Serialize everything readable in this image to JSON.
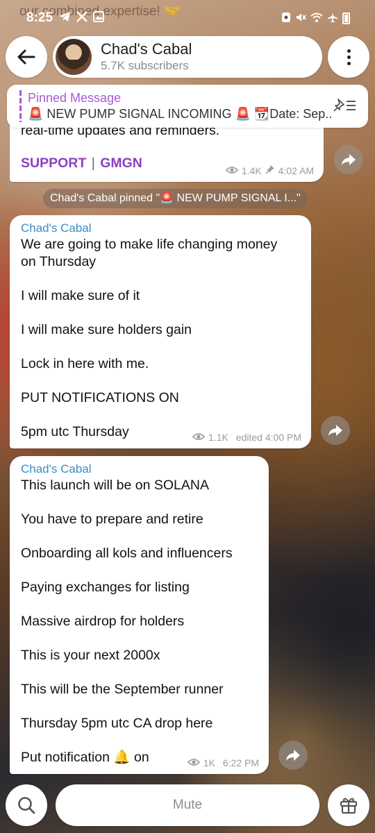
{
  "status_bar": {
    "time": "8:25",
    "left_icons": [
      "telegram-icon",
      "x-icon",
      "gallery-icon"
    ],
    "right_icons": [
      "nfc-icon",
      "mute-icon",
      "wifi-icon",
      "airplane-icon",
      "battery-icon"
    ]
  },
  "background_text": "our combined expertise! 🤝",
  "header": {
    "channel_name": "Chad's Cabal",
    "subscribers": "5.7K subscribers"
  },
  "pinned": {
    "title": "Pinned Message",
    "preview": "🚨 NEW PUMP SIGNAL INCOMING 🚨 📆Date: Sep..."
  },
  "messages": [
    {
      "partial_text": "real-time updates and reminders.",
      "links": [
        "SUPPORT",
        "GMGN"
      ],
      "link_separator": "|",
      "views": "1.4K",
      "time": "4:02 AM"
    },
    {
      "sender": "Chad's Cabal",
      "lines": [
        "We are going to make life changing money",
        "on Thursday",
        "",
        "I will make sure of it",
        "",
        "I will make sure holders gain",
        "",
        "Lock in here with me.",
        "",
        "PUT NOTIFICATIONS ON",
        "",
        "5pm utc Thursday"
      ],
      "views": "1.1K",
      "time": "edited 4:00 PM"
    },
    {
      "sender": "Chad's Cabal",
      "lines": [
        "This launch will be on SOLANA",
        "",
        "You have to prepare and retire",
        "",
        "Onboarding all kols and influencers",
        "",
        "Paying exchanges for listing",
        "",
        "Massive airdrop for holders",
        "",
        "This is your next 2000x",
        "",
        "This will be the September runner",
        "",
        "Thursday 5pm utc CA drop here",
        "",
        "Put notification 🔔 on"
      ],
      "views": "1K",
      "time": "6:22 PM"
    }
  ],
  "service_message": "Chad's Cabal pinned \"🚨 NEW PUMP SIGNAL I...\"",
  "bottom_bar": {
    "mute_label": "Mute"
  }
}
